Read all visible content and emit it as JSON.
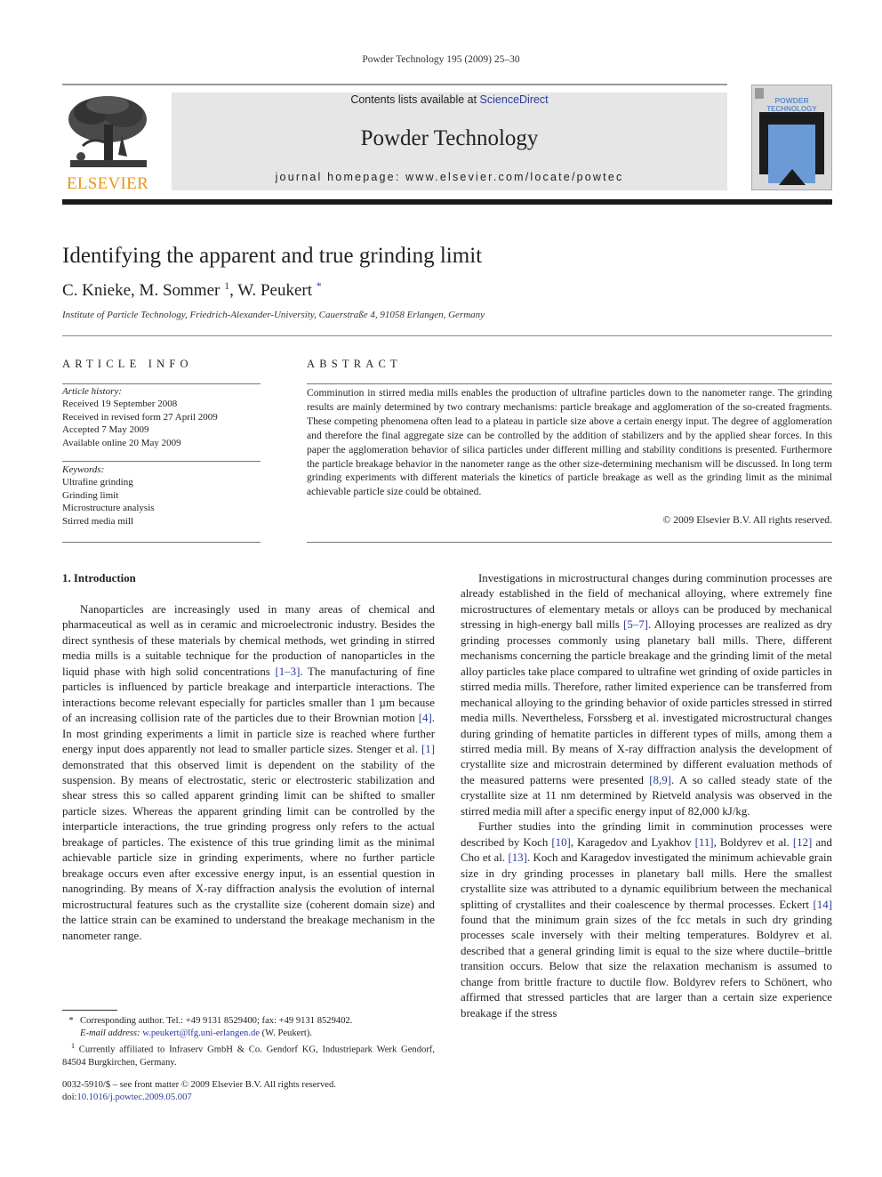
{
  "running_head": "Powder Technology 195 (2009) 25–30",
  "header": {
    "publisher_logo": {
      "icon": "elsevier-tree-icon",
      "wordmark": "ELSEVIER",
      "color": "#e8961a"
    },
    "contents_prefix": "Contents lists available at ",
    "contents_link": "ScienceDirect",
    "journal_name": "Powder Technology",
    "homepage": "journal homepage: www.elsevier.com/locate/powtec",
    "cover": {
      "title_line1": "POWDER",
      "title_line2": "TECHNOLOGY",
      "accent": "#6b9bd6"
    }
  },
  "article": {
    "title": "Identifying the apparent and true grinding limit",
    "authors": [
      {
        "name": "C. Knieke",
        "mark": "",
        "sep": ", "
      },
      {
        "name": "M. Sommer ",
        "mark": "1",
        "sep": ", "
      },
      {
        "name": "W. Peukert ",
        "mark": "*",
        "sep": ""
      }
    ],
    "affiliation": "Institute of Particle Technology, Friedrich-Alexander-University, Cauerstraße 4, 91058 Erlangen, Germany"
  },
  "article_info": {
    "heading": "ARTICLE INFO",
    "history_label": "Article history:",
    "history": [
      "Received 19 September 2008",
      "Received in revised form 27 April 2009",
      "Accepted 7 May 2009",
      "Available online 20 May 2009"
    ],
    "keywords_label": "Keywords:",
    "keywords": [
      "Ultrafine grinding",
      "Grinding limit",
      "Microstructure analysis",
      "Stirred media mill"
    ]
  },
  "abstract": {
    "heading": "ABSTRACT",
    "text": "Comminution in stirred media mills enables the production of ultrafine particles down to the nanometer range. The grinding results are mainly determined by two contrary mechanisms: particle breakage and agglomeration of the so-created fragments. These competing phenomena often lead to a plateau in particle size above a certain energy input. The degree of agglomeration and therefore the final aggregate size can be controlled by the addition of stabilizers and by the applied shear forces. In this paper the agglomeration behavior of silica particles under different milling and stability conditions is presented. Furthermore the particle breakage behavior in the nanometer range as the other size-determining mechanism will be discussed. In long term grinding experiments with different materials the kinetics of particle breakage as well as the grinding limit as the minimal achievable particle size could be obtained.",
    "copyright": "© 2009 Elsevier B.V. All rights reserved."
  },
  "body": {
    "section_heading": "1. Introduction",
    "left_paragraph": [
      {
        "t": "Nanoparticles are increasingly used in many areas of chemical and pharmaceutical as well as in ceramic and microelectronic industry. Besides the direct synthesis of these materials by chemical methods, wet grinding in stirred media mills is a suitable technique for the production of nanoparticles in the liquid phase with high solid concentrations "
      },
      {
        "ref": "[1–3]"
      },
      {
        "t": ". The manufacturing of fine particles is influenced by particle breakage and interparticle interactions. The interactions become relevant especially for particles smaller than 1 µm because of an increasing collision rate of the particles due to their Brownian motion "
      },
      {
        "ref": "[4]"
      },
      {
        "t": ". In most grinding experiments a limit in particle size is reached where further energy input does apparently not lead to smaller particle sizes. Stenger et al. "
      },
      {
        "ref": "[1]"
      },
      {
        "t": " demonstrated that this observed limit is dependent on the stability of the suspension. By means of electrostatic, steric or electrosteric stabilization and shear stress this so called apparent grinding limit can be shifted to smaller particle sizes. Whereas the apparent grinding limit can be controlled by the interparticle interactions, the true grinding progress only refers to the actual breakage of particles. The existence of this true grinding limit as the minimal achievable particle size in grinding experiments, where no further particle breakage occurs even after excessive energy input, is an essential question in nanogrinding. By means of X-ray diffraction analysis the evolution of internal microstructural features such as the crystallite size (coherent domain size) and the lattice strain can be examined to understand the breakage mechanism in the nanometer range."
      }
    ],
    "right_paragraph_1": [
      {
        "t": "Investigations in microstructural changes during comminution processes are already established in the field of mechanical alloying, where extremely fine microstructures of elementary metals or alloys can be produced by mechanical stressing in high-energy ball mills "
      },
      {
        "ref": "[5–7]"
      },
      {
        "t": ". Alloying processes are realized as dry grinding processes commonly using planetary ball mills. There, different mechanisms concerning the particle breakage and the grinding limit of the metal alloy particles take place compared to ultrafine wet grinding of oxide particles in stirred media mills. Therefore, rather limited experience can be transferred from mechanical alloying to the grinding behavior of oxide particles stressed in stirred media mills. Nevertheless, Forssberg et al. investigated microstructural changes during grinding of hematite particles in different types of mills, among them a stirred media mill. By means of X-ray diffraction analysis the development of crystallite size and microstrain determined by different evaluation methods of the measured patterns were presented "
      },
      {
        "ref": "[8,9]"
      },
      {
        "t": ". A so called steady state of the crystallite size at 11 nm determined by Rietveld analysis was observed in the stirred media mill after a specific energy input of 82,000 kJ/kg."
      }
    ],
    "right_paragraph_2": [
      {
        "t": "Further studies into the grinding limit in comminution processes were described by Koch "
      },
      {
        "ref": "[10]"
      },
      {
        "t": ", Karagedov and Lyakhov "
      },
      {
        "ref": "[11]"
      },
      {
        "t": ", Boldyrev et al. "
      },
      {
        "ref": "[12]"
      },
      {
        "t": " and Cho et al. "
      },
      {
        "ref": "[13]"
      },
      {
        "t": ". Koch and Karagedov investigated the minimum achievable grain size in dry grinding processes in planetary ball mills. Here the smallest crystallite size was attributed to a dynamic equilibrium between the mechanical splitting of crystallites and their coalescence by thermal processes. Eckert "
      },
      {
        "ref": "[14]"
      },
      {
        "t": " found that the minimum grain sizes of the fcc metals in such dry grinding processes scale inversely with their melting temperatures. Boldyrev et al. described that a general grinding limit is equal to the size where ductile–brittle transition occurs. Below that size the relaxation mechanism is assumed to change from brittle fracture to ductile flow. Boldyrev refers to Schönert, who affirmed that stressed particles that are larger than a certain size experience breakage if the stress"
      }
    ]
  },
  "footnotes": {
    "corresponding_mark": "*",
    "corresponding": "Corresponding author. Tel.: +49 9131 8529400; fax: +49 9131 8529402.",
    "email_label": "E-mail address:",
    "email": "w.peukert@lfg.uni-erlangen.de",
    "email_suffix": " (W. Peukert).",
    "affil_mark": "1",
    "affil": " Currently affiliated to Infraserv GmbH & Co. Gendorf KG, Industriepark Werk Gendorf, 84504 Burgkirchen, Germany."
  },
  "front_matter": {
    "issn_line": "0032-5910/$ – see front matter © 2009 Elsevier B.V. All rights reserved.",
    "doi_label": "doi:",
    "doi": "10.1016/j.powtec.2009.05.007"
  },
  "colors": {
    "link": "#2a3a9c",
    "band": "#e6e6e6",
    "elsevier_orange": "#e8961a"
  }
}
